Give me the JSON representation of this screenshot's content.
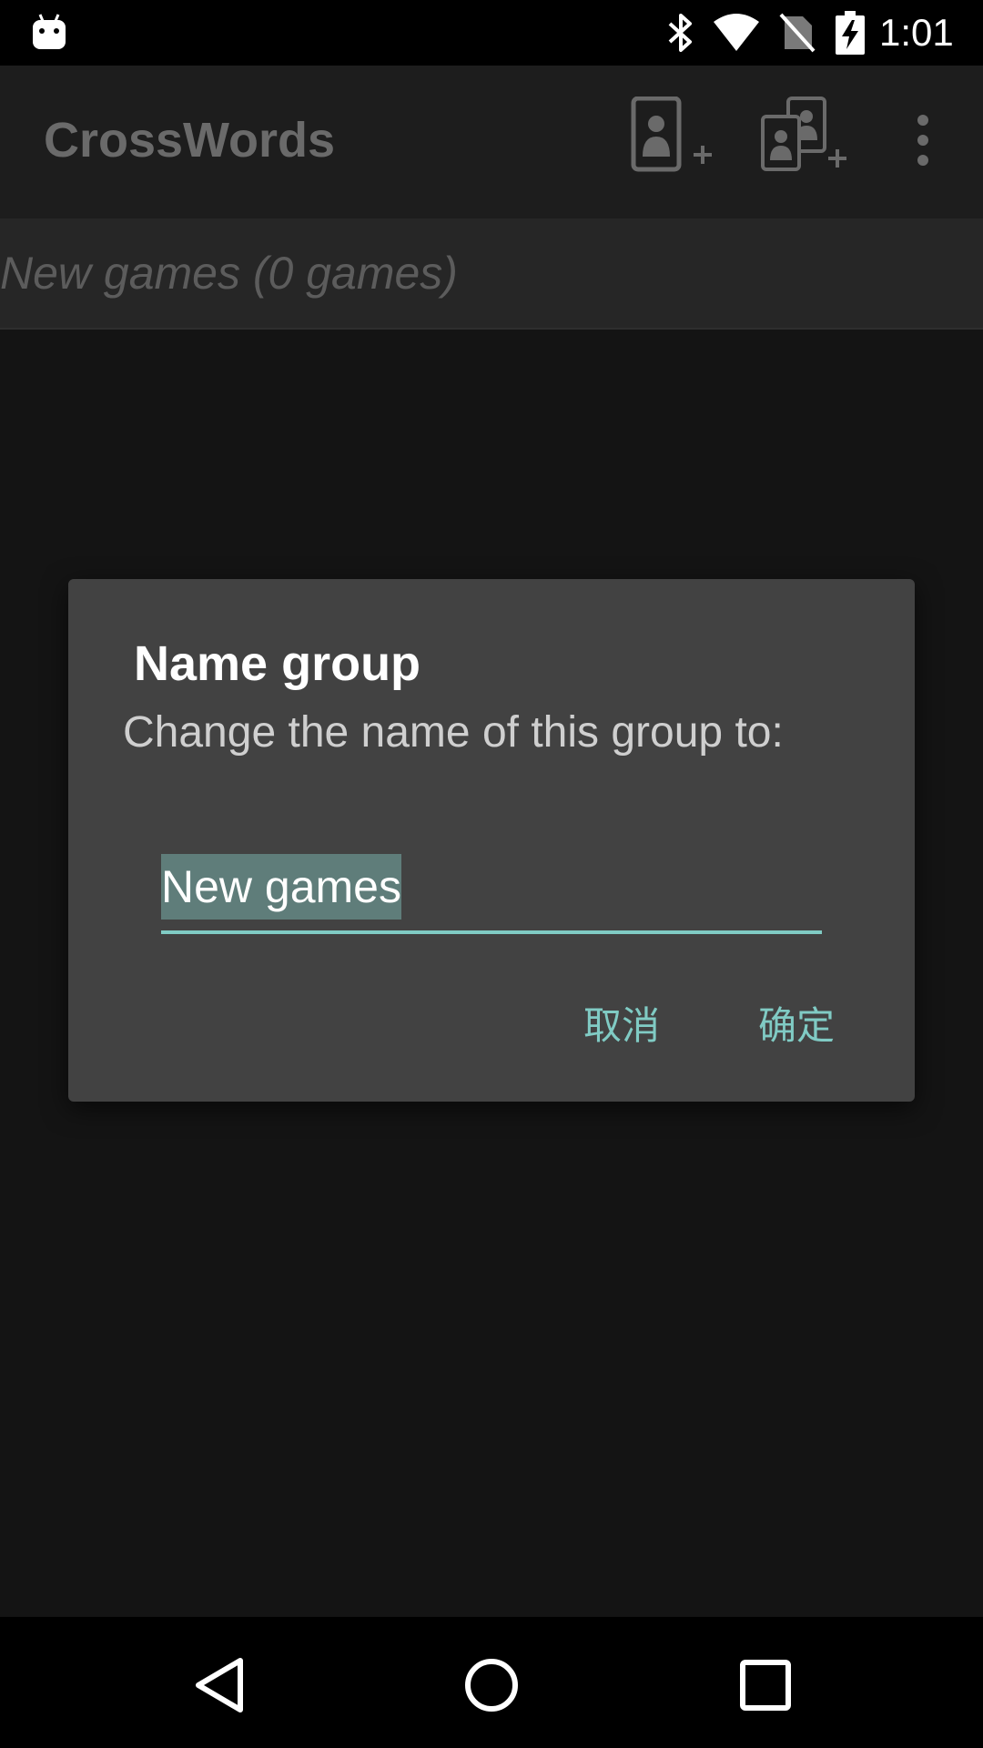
{
  "status_bar": {
    "time": "1:01",
    "icons": [
      "android-icon",
      "bluetooth-icon",
      "wifi-icon",
      "no-sim-icon",
      "battery-charging-icon"
    ]
  },
  "action_bar": {
    "title": "CrossWords",
    "icons": [
      "new-game-icon",
      "new-network-game-icon",
      "overflow-menu-icon"
    ]
  },
  "group_list": {
    "groups": [
      {
        "label": "New games (0 games)"
      }
    ]
  },
  "dialog": {
    "title": "Name group",
    "message": "Change the name of this group to:",
    "input_value": "New games",
    "cancel_label": "取消",
    "ok_label": "确定"
  },
  "nav_bar": {
    "icons": [
      "back-icon",
      "home-icon",
      "recents-icon"
    ]
  },
  "colors": {
    "accent": "#80cbc4",
    "dialog_bg": "#424242",
    "selection": "#5f7d7a",
    "background": "#141414"
  }
}
